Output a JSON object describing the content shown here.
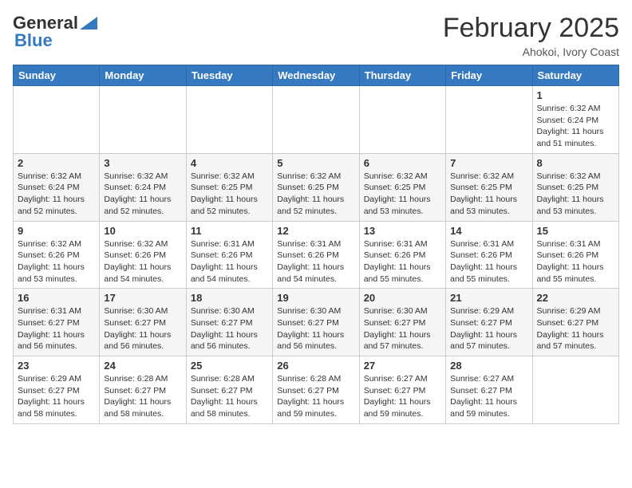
{
  "header": {
    "logo_general": "General",
    "logo_blue": "Blue",
    "month_title": "February 2025",
    "location": "Ahokoi, Ivory Coast"
  },
  "days_of_week": [
    "Sunday",
    "Monday",
    "Tuesday",
    "Wednesday",
    "Thursday",
    "Friday",
    "Saturday"
  ],
  "weeks": [
    [
      {
        "day": "",
        "info": ""
      },
      {
        "day": "",
        "info": ""
      },
      {
        "day": "",
        "info": ""
      },
      {
        "day": "",
        "info": ""
      },
      {
        "day": "",
        "info": ""
      },
      {
        "day": "",
        "info": ""
      },
      {
        "day": "1",
        "info": "Sunrise: 6:32 AM\nSunset: 6:24 PM\nDaylight: 11 hours and 51 minutes."
      }
    ],
    [
      {
        "day": "2",
        "info": "Sunrise: 6:32 AM\nSunset: 6:24 PM\nDaylight: 11 hours and 52 minutes."
      },
      {
        "day": "3",
        "info": "Sunrise: 6:32 AM\nSunset: 6:24 PM\nDaylight: 11 hours and 52 minutes."
      },
      {
        "day": "4",
        "info": "Sunrise: 6:32 AM\nSunset: 6:25 PM\nDaylight: 11 hours and 52 minutes."
      },
      {
        "day": "5",
        "info": "Sunrise: 6:32 AM\nSunset: 6:25 PM\nDaylight: 11 hours and 52 minutes."
      },
      {
        "day": "6",
        "info": "Sunrise: 6:32 AM\nSunset: 6:25 PM\nDaylight: 11 hours and 53 minutes."
      },
      {
        "day": "7",
        "info": "Sunrise: 6:32 AM\nSunset: 6:25 PM\nDaylight: 11 hours and 53 minutes."
      },
      {
        "day": "8",
        "info": "Sunrise: 6:32 AM\nSunset: 6:25 PM\nDaylight: 11 hours and 53 minutes."
      }
    ],
    [
      {
        "day": "9",
        "info": "Sunrise: 6:32 AM\nSunset: 6:26 PM\nDaylight: 11 hours and 53 minutes."
      },
      {
        "day": "10",
        "info": "Sunrise: 6:32 AM\nSunset: 6:26 PM\nDaylight: 11 hours and 54 minutes."
      },
      {
        "day": "11",
        "info": "Sunrise: 6:31 AM\nSunset: 6:26 PM\nDaylight: 11 hours and 54 minutes."
      },
      {
        "day": "12",
        "info": "Sunrise: 6:31 AM\nSunset: 6:26 PM\nDaylight: 11 hours and 54 minutes."
      },
      {
        "day": "13",
        "info": "Sunrise: 6:31 AM\nSunset: 6:26 PM\nDaylight: 11 hours and 55 minutes."
      },
      {
        "day": "14",
        "info": "Sunrise: 6:31 AM\nSunset: 6:26 PM\nDaylight: 11 hours and 55 minutes."
      },
      {
        "day": "15",
        "info": "Sunrise: 6:31 AM\nSunset: 6:26 PM\nDaylight: 11 hours and 55 minutes."
      }
    ],
    [
      {
        "day": "16",
        "info": "Sunrise: 6:31 AM\nSunset: 6:27 PM\nDaylight: 11 hours and 56 minutes."
      },
      {
        "day": "17",
        "info": "Sunrise: 6:30 AM\nSunset: 6:27 PM\nDaylight: 11 hours and 56 minutes."
      },
      {
        "day": "18",
        "info": "Sunrise: 6:30 AM\nSunset: 6:27 PM\nDaylight: 11 hours and 56 minutes."
      },
      {
        "day": "19",
        "info": "Sunrise: 6:30 AM\nSunset: 6:27 PM\nDaylight: 11 hours and 56 minutes."
      },
      {
        "day": "20",
        "info": "Sunrise: 6:30 AM\nSunset: 6:27 PM\nDaylight: 11 hours and 57 minutes."
      },
      {
        "day": "21",
        "info": "Sunrise: 6:29 AM\nSunset: 6:27 PM\nDaylight: 11 hours and 57 minutes."
      },
      {
        "day": "22",
        "info": "Sunrise: 6:29 AM\nSunset: 6:27 PM\nDaylight: 11 hours and 57 minutes."
      }
    ],
    [
      {
        "day": "23",
        "info": "Sunrise: 6:29 AM\nSunset: 6:27 PM\nDaylight: 11 hours and 58 minutes."
      },
      {
        "day": "24",
        "info": "Sunrise: 6:28 AM\nSunset: 6:27 PM\nDaylight: 11 hours and 58 minutes."
      },
      {
        "day": "25",
        "info": "Sunrise: 6:28 AM\nSunset: 6:27 PM\nDaylight: 11 hours and 58 minutes."
      },
      {
        "day": "26",
        "info": "Sunrise: 6:28 AM\nSunset: 6:27 PM\nDaylight: 11 hours and 59 minutes."
      },
      {
        "day": "27",
        "info": "Sunrise: 6:27 AM\nSunset: 6:27 PM\nDaylight: 11 hours and 59 minutes."
      },
      {
        "day": "28",
        "info": "Sunrise: 6:27 AM\nSunset: 6:27 PM\nDaylight: 11 hours and 59 minutes."
      },
      {
        "day": "",
        "info": ""
      }
    ]
  ]
}
